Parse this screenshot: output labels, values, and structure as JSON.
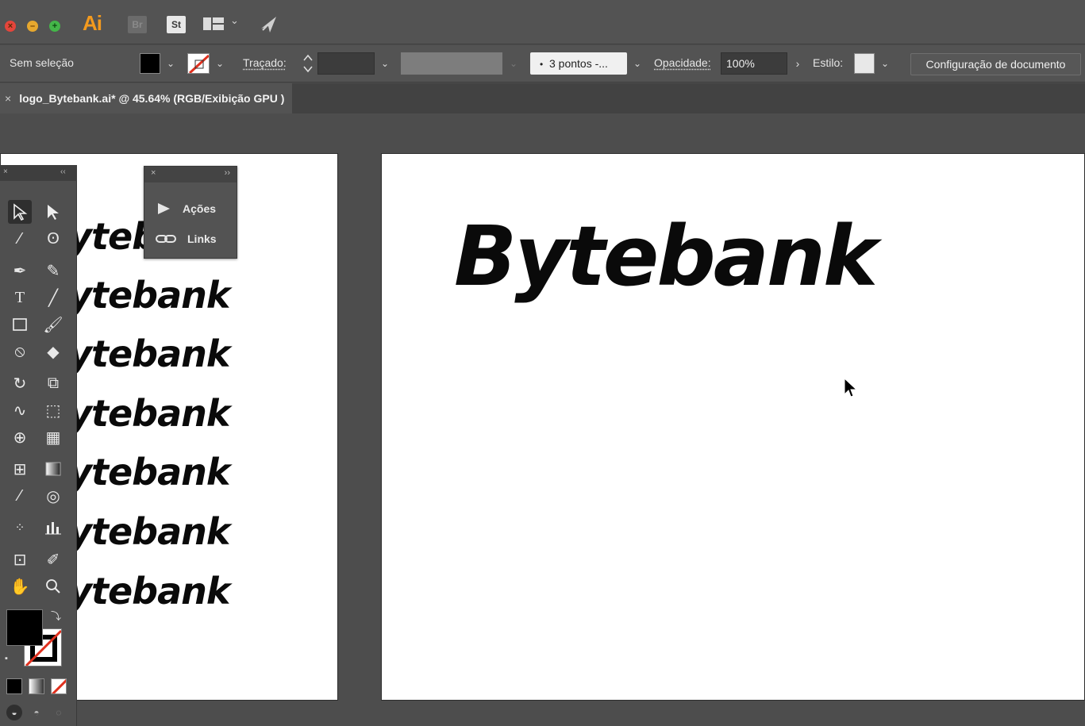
{
  "app": {
    "logo_text": "Ai",
    "bridge_chip": "Br",
    "stock_chip": "St",
    "traffic_lights": {
      "close": "#e5453b",
      "minimize": "#e7a82e",
      "zoom": "#44b649"
    }
  },
  "control_bar": {
    "selection_status": "Sem seleção",
    "stroke_label": "Traçado:",
    "brush_preset": "3 pontos -...",
    "opacity_label": "Opacidade:",
    "opacity_value": "100%",
    "style_label": "Estilo:",
    "doc_setup_button": "Configuração de documento"
  },
  "document_tab": {
    "close_glyph": "×",
    "title": "logo_Bytebank.ai* @ 45.64% (RGB/Exibição GPU )"
  },
  "canvas": {
    "main_logo_text": "Bytebank",
    "left_artboard_rows": [
      "yteb",
      "ytebank",
      "ytebank",
      "ytebank",
      "ytebank",
      "ytebank",
      "ytebank"
    ]
  },
  "floating_panel": {
    "items": [
      {
        "label": "Ações",
        "icon": "play-icon"
      },
      {
        "label": "Links",
        "icon": "link-icon"
      }
    ]
  },
  "tools_panel": {
    "tools": [
      "selection-tool",
      "direct-selection-tool",
      "magic-wand-tool",
      "lasso-tool",
      "pen-tool",
      "curvature-tool",
      "type-tool",
      "line-segment-tool",
      "rectangle-tool",
      "paintbrush-tool",
      "shaper-tool",
      "eraser-tool",
      "rotate-tool",
      "scale-tool",
      "warp-tool",
      "free-transform-tool",
      "shape-builder-tool",
      "perspective-grid-tool",
      "mesh-tool",
      "gradient-tool",
      "eyedropper-tool",
      "blend-tool",
      "symbol-sprayer-tool",
      "column-graph-tool",
      "artboard-tool",
      "slice-tool",
      "hand-tool",
      "zoom-tool"
    ],
    "fill_color": "#000000",
    "stroke_color": "none"
  },
  "colors": {
    "ui_dark": "#535353",
    "canvas_bg": "#4d4d4d",
    "accent_ai": "#f39a1e"
  }
}
